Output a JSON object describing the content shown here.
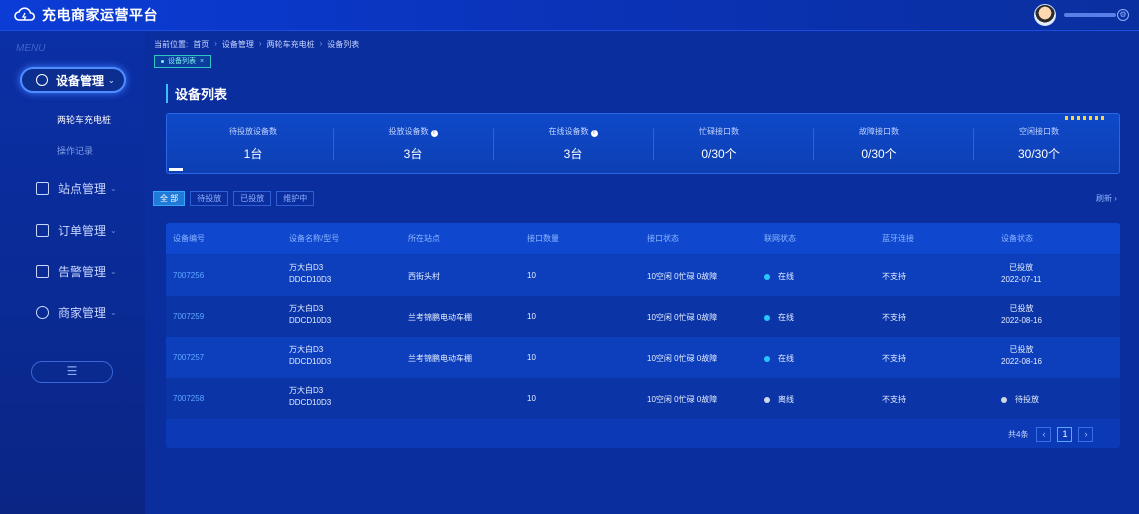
{
  "header": {
    "app_title": "充电商家运营平台",
    "logo_icon": "cloud-lightning-icon",
    "avatar_icon": "user-avatar",
    "user_icon": "settings-icon"
  },
  "sidebar": {
    "menu_tag": "MENU",
    "items": [
      {
        "label": "设备管理",
        "icon": "gear-icon",
        "active": true
      },
      {
        "label": "站点管理",
        "icon": "network-icon"
      },
      {
        "label": "订单管理",
        "icon": "document-icon"
      },
      {
        "label": "告警管理",
        "icon": "bell-icon"
      },
      {
        "label": "商家管理",
        "icon": "user-icon"
      }
    ],
    "sub_items": [
      {
        "label": "两轮车充电桩",
        "active": true
      },
      {
        "label": "操作记录",
        "active": false
      }
    ],
    "collapse_icon": "menu-icon",
    "collapse_label": "☰"
  },
  "breadcrumb": {
    "items": [
      "当前位置:",
      "首页",
      "设备管理",
      "两轮车充电桩",
      "设备列表"
    ],
    "separator": "›"
  },
  "tag": {
    "label": "设备列表",
    "close": "×"
  },
  "page_title": "设备列表",
  "stats": [
    {
      "label": "待投放设备数",
      "value": "1台"
    },
    {
      "label": "投放设备数",
      "value": "3台"
    },
    {
      "label": "在线设备数",
      "value": "3台"
    },
    {
      "label": "忙碌接口数",
      "value": "0/30个"
    },
    {
      "label": "故障接口数",
      "value": "0/30个"
    },
    {
      "label": "空闲接口数",
      "value": "30/30个"
    }
  ],
  "filters": [
    "全 部",
    "待投放",
    "已投放",
    "维护中"
  ],
  "refresh": "刷新 ›",
  "table": {
    "headers": [
      "设备编号",
      "设备名称/型号",
      "所在站点",
      "接口数量",
      "接口状态",
      "联网状态",
      "蓝牙连接",
      "设备状态"
    ],
    "rows": [
      {
        "id": "7007256",
        "name": "万大白D3",
        "model": "DDCD10D3",
        "site": "西街头村",
        "ports": "10",
        "port_status": "10空闲 0忙碌 0故障",
        "network": "在线",
        "network_state": "online",
        "bluetooth": "不支持",
        "status": "已投放",
        "date": "2022-07-11"
      },
      {
        "id": "7007259",
        "name": "万大白D3",
        "model": "DDCD10D3",
        "site": "兰考锦鹏电动车棚",
        "ports": "10",
        "port_status": "10空闲 0忙碌 0故障",
        "network": "在线",
        "network_state": "online",
        "bluetooth": "不支持",
        "status": "已投放",
        "date": "2022-08-16"
      },
      {
        "id": "7007257",
        "name": "万大白D3",
        "model": "DDCD10D3",
        "site": "兰考锦鹏电动车棚",
        "ports": "10",
        "port_status": "10空闲 0忙碌 0故障",
        "network": "在线",
        "network_state": "online",
        "bluetooth": "不支持",
        "status": "已投放",
        "date": "2022-08-16"
      },
      {
        "id": "7007258",
        "name": "万大白D3",
        "model": "DDCD10D3",
        "site": "",
        "ports": "10",
        "port_status": "10空闲 0忙碌 0故障",
        "network": "离线",
        "network_state": "offline",
        "bluetooth": "不支持",
        "status": "待投放",
        "date": ""
      }
    ]
  },
  "pagination": {
    "total": "共4条",
    "prev": "‹",
    "current": "1",
    "next": "›"
  },
  "colors": {
    "accent": "#27c6ff",
    "primary": "#0b2e9e",
    "highlight": "#4f8dff"
  }
}
